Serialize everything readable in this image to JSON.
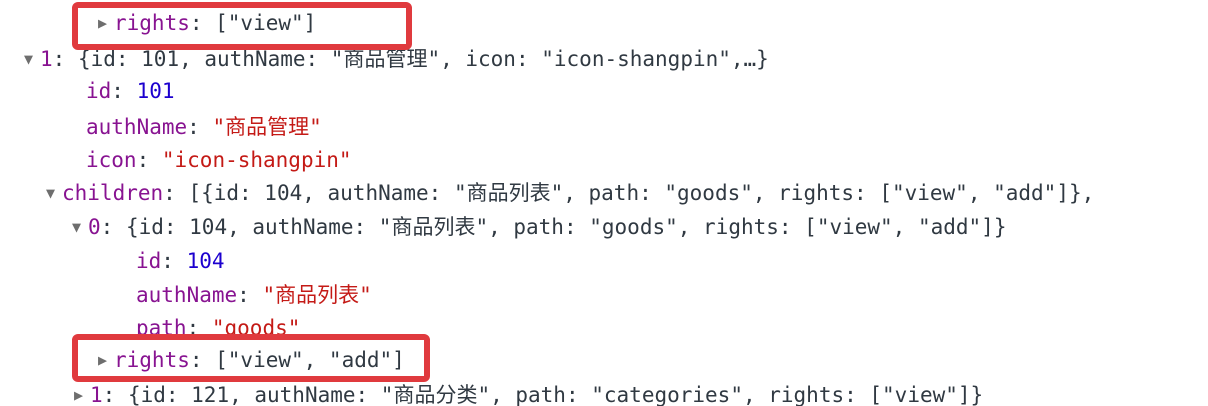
{
  "console": {
    "rows": [
      {
        "name": "rights-collapsed-1",
        "twisty": "▶",
        "parts": [
          {
            "cls": "key",
            "text": "rights"
          },
          {
            "cls": "punc",
            "text": ": [\"view\"]"
          }
        ]
      },
      {
        "name": "item-1-expanded",
        "twisty": "▼",
        "parts": [
          {
            "cls": "idx",
            "text": "1"
          },
          {
            "cls": "punc",
            "text": ": {id: 101, authName: \""
          },
          {
            "cls": "punc cjk",
            "text": "商品管理"
          },
          {
            "cls": "punc",
            "text": "\", icon: \"icon-shangpin\",…}"
          }
        ]
      },
      {
        "name": "prop-id",
        "twisty": "",
        "parts": [
          {
            "cls": "key",
            "text": "id"
          },
          {
            "cls": "punc",
            "text": ": "
          },
          {
            "cls": "num",
            "text": "101"
          }
        ]
      },
      {
        "name": "prop-authname",
        "twisty": "",
        "parts": [
          {
            "cls": "key",
            "text": "authName"
          },
          {
            "cls": "punc",
            "text": ": "
          },
          {
            "cls": "str",
            "text": "\""
          },
          {
            "cls": "str cjk",
            "text": "商品管理"
          },
          {
            "cls": "str",
            "text": "\""
          }
        ]
      },
      {
        "name": "prop-icon",
        "twisty": "",
        "parts": [
          {
            "cls": "key",
            "text": "icon"
          },
          {
            "cls": "punc",
            "text": ": "
          },
          {
            "cls": "str",
            "text": "\"icon-shangpin\""
          }
        ]
      },
      {
        "name": "children-expanded",
        "twisty": "▼",
        "parts": [
          {
            "cls": "key",
            "text": "children"
          },
          {
            "cls": "punc",
            "text": ": [{id: 104, authName: \""
          },
          {
            "cls": "punc cjk",
            "text": "商品列表"
          },
          {
            "cls": "punc",
            "text": "\", path: \"goods\", rights: [\"view\", \"add\"]},"
          }
        ]
      },
      {
        "name": "child-0-expanded",
        "twisty": "▼",
        "parts": [
          {
            "cls": "idx",
            "text": "0"
          },
          {
            "cls": "punc",
            "text": ": {id: 104, authName: \""
          },
          {
            "cls": "punc cjk",
            "text": "商品列表"
          },
          {
            "cls": "punc",
            "text": "\", path: \"goods\", rights: [\"view\", \"add\"]}"
          }
        ]
      },
      {
        "name": "child-prop-id",
        "twisty": "",
        "parts": [
          {
            "cls": "key",
            "text": "id"
          },
          {
            "cls": "punc",
            "text": ": "
          },
          {
            "cls": "num",
            "text": "104"
          }
        ]
      },
      {
        "name": "child-prop-authname",
        "twisty": "",
        "parts": [
          {
            "cls": "key",
            "text": "authName"
          },
          {
            "cls": "punc",
            "text": ": "
          },
          {
            "cls": "str",
            "text": "\""
          },
          {
            "cls": "str cjk",
            "text": "商品列表"
          },
          {
            "cls": "str",
            "text": "\""
          }
        ]
      },
      {
        "name": "child-prop-path",
        "twisty": "",
        "parts": [
          {
            "cls": "key",
            "text": "path"
          },
          {
            "cls": "punc",
            "text": ": "
          },
          {
            "cls": "str",
            "text": "\"goods\""
          }
        ]
      },
      {
        "name": "rights-collapsed-2",
        "twisty": "▶",
        "parts": [
          {
            "cls": "key",
            "text": "rights"
          },
          {
            "cls": "punc",
            "text": ": [\"view\", \"add\"]"
          }
        ]
      },
      {
        "name": "child-1-collapsed",
        "twisty": "▶",
        "parts": [
          {
            "cls": "idx",
            "text": "1"
          },
          {
            "cls": "punc",
            "text": ": {id: 121, authName: \""
          },
          {
            "cls": "punc cjk",
            "text": "商品分类"
          },
          {
            "cls": "punc",
            "text": "\", path: \"categories\", rights: [\"view\"]}"
          }
        ]
      }
    ]
  },
  "highlight": {
    "color": "#e03a3e"
  }
}
